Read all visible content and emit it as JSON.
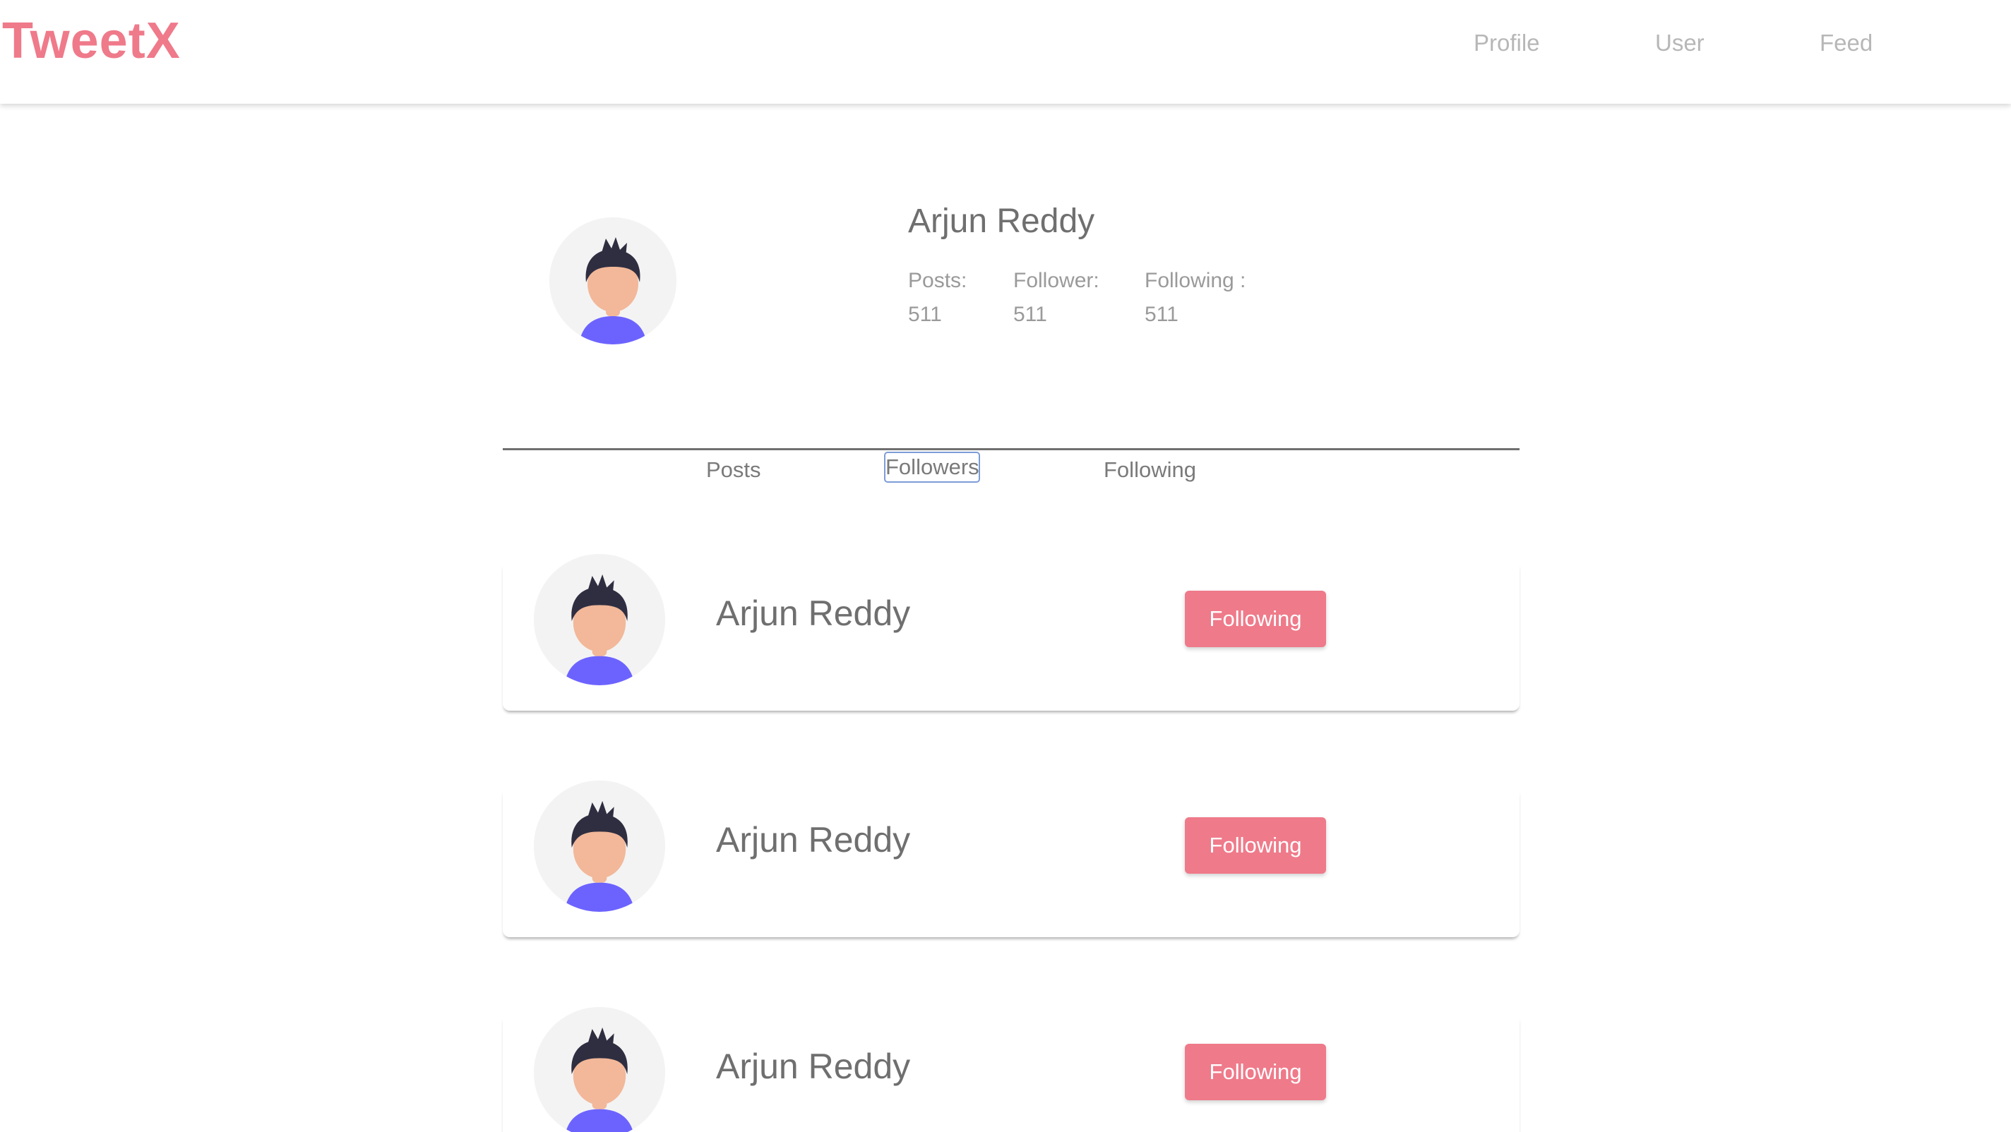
{
  "header": {
    "logo": "TweetX",
    "nav": [
      {
        "label": "Profile"
      },
      {
        "label": "User"
      },
      {
        "label": "Feed"
      }
    ]
  },
  "profile": {
    "name": "Arjun Reddy",
    "stats": {
      "posts_label": "Posts:",
      "posts_value": "511",
      "followers_label": "Follower:",
      "followers_value": "511",
      "following_label": "Following :",
      "following_value": "511"
    }
  },
  "tabs": [
    {
      "label": "Posts"
    },
    {
      "label": "Followers",
      "selected": true
    },
    {
      "label": "Following"
    }
  ],
  "followers": [
    {
      "name": "Arjun Reddy",
      "button": "Following"
    },
    {
      "name": "Arjun Reddy",
      "button": "Following"
    },
    {
      "name": "Arjun Reddy",
      "button": "Following"
    }
  ],
  "colors": {
    "accent": "#ef7a8a",
    "text_muted": "#6f6f6f",
    "avatar_shirt": "#6c63ff",
    "avatar_skin": "#f2b899",
    "avatar_hair": "#2f2e41"
  }
}
